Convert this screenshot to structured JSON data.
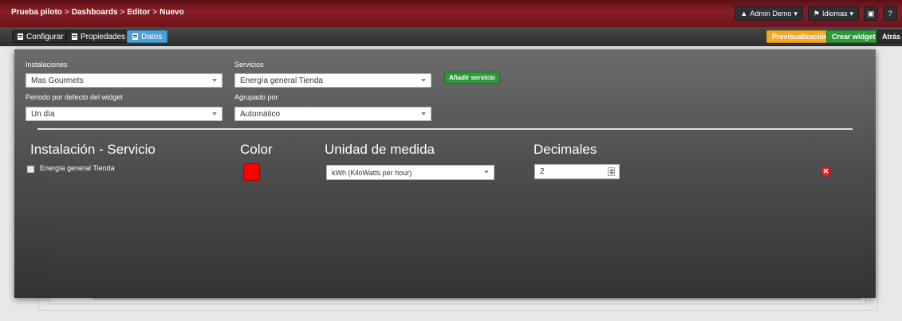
{
  "breadcrumb": [
    "Prueba piloto",
    "Dashboards",
    "Editor",
    "Nuevo"
  ],
  "breadcrumb_sep": ">",
  "header": {
    "user_label": "Admin Demo",
    "language_label": "Idiomas",
    "help_label": "?"
  },
  "tabs": [
    {
      "label": "Configurar",
      "active": false
    },
    {
      "label": "Propiedades",
      "active": false
    },
    {
      "label": "Datos",
      "active": true
    }
  ],
  "toolbar": {
    "preview_label": "Previsualización",
    "create_label": "Crear widget",
    "back_label": "Atrás"
  },
  "form": {
    "installations_label": "Instalaciones",
    "installations_value": "Mas Gourmets",
    "services_label": "Servicios",
    "services_value": "Energía general Tienda",
    "add_service_label": "Añadir servicio",
    "period_label": "Periodo por defecto del widget",
    "period_value": "Un día",
    "grouped_label": "Agrupado por",
    "grouped_value": "Automático"
  },
  "table": {
    "headers": [
      "Instalación - Servicio",
      "Color",
      "Unidad de medida",
      "Decimales"
    ],
    "rows": [
      {
        "service": "Energía general Tienda",
        "color": "#ff0000",
        "unit": "kWh (KiloWatts per hour)",
        "decimals": "2"
      }
    ]
  },
  "colors": {
    "header": "#8a1d25",
    "active_tab": "#4a9fd4",
    "preview": "#f4a82a",
    "create": "#2c9a3a",
    "remove": "#e3262c"
  }
}
